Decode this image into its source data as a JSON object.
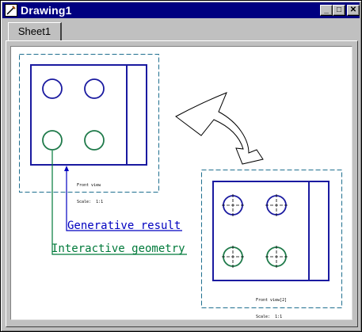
{
  "window": {
    "title": "Drawing1",
    "minimize_glyph": "_",
    "maximize_glyph": "□",
    "close_glyph": "✕"
  },
  "tabs": [
    {
      "label": "Sheet1",
      "selected": true
    }
  ],
  "views": {
    "front": {
      "name": "Front view",
      "scale": "Scale:  1:1"
    },
    "front2": {
      "name": "Front view[2]",
      "scale": "Scale:  1:1"
    }
  },
  "callouts": {
    "generative": "Generative result",
    "interactive": "Interactive geometry"
  },
  "colors": {
    "titlebar": "#000080",
    "geometry_blue": "#1a1aa0",
    "geometry_green": "#1f7a4a",
    "frame_dashed": "#1f6f8f",
    "callout_blue": "#0000c0",
    "callout_green": "#007a3a"
  },
  "icons": {
    "app": "drawing-app-icon",
    "arrow": "transform-arrow-icon"
  }
}
